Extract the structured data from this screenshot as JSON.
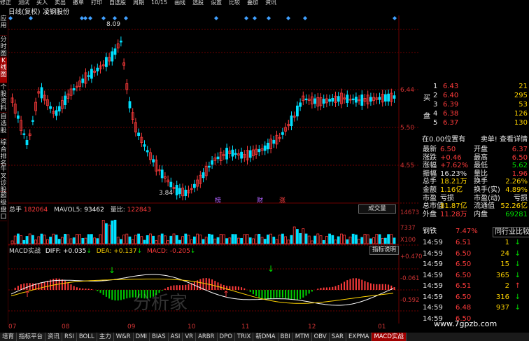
{
  "menu": [
    "修正",
    "测试",
    "买入",
    "卖出",
    "撤单",
    "打印",
    "自选股",
    "周期",
    "10/15",
    "画线",
    "选股",
    "设置",
    "比较",
    "叠加",
    "资讯"
  ],
  "title": {
    "mode": "日线(复权)",
    "stock": "凌钢股份"
  },
  "sidebar": [
    {
      "label": "应用",
      "active": false
    },
    {
      "label": "分时图",
      "active": false
    },
    {
      "label": "K线图",
      "active": true
    },
    {
      "label": "个股资料",
      "active": false
    },
    {
      "label": "自选股",
      "active": false
    },
    {
      "label": "综合排名",
      "active": false
    },
    {
      "label": "牛叉诊股",
      "active": false
    },
    {
      "label": "超级盘口",
      "active": false
    }
  ],
  "price_axis": [
    "6.44",
    "5.50",
    "4.55"
  ],
  "price_marks": {
    "high": "8.09",
    "low": "3.84"
  },
  "event_labels": [
    {
      "text": "榜",
      "color": "#b060ff"
    },
    {
      "text": "财",
      "color": "#b060ff"
    },
    {
      "text": "涨",
      "color": "#ff4040"
    }
  ],
  "volume": {
    "label": "总手",
    "value": "182064",
    "ma_label": "MAVOL5:",
    "ma_value": "93462",
    "ratio_label": "量比:",
    "ratio_value": "122843",
    "axis": [
      "14673",
      "7337",
      "X100"
    ],
    "button": "成交量"
  },
  "macd": {
    "name": "MACD实战",
    "diff": "DIFF: +0.035",
    "dea": "DEA: +0.137",
    "macd": "MACD: -0.205",
    "axis": [
      "+0.470",
      "-0.061",
      "-0.592"
    ],
    "button": "指标说明"
  },
  "dates": [
    "07",
    "08",
    "09",
    "10",
    "11",
    "12",
    "01"
  ],
  "order_book": [
    {
      "side": "卖",
      "level": "1",
      "price": "6.43",
      "vol": "21"
    },
    {
      "side": "",
      "level": "2",
      "price": "6.40",
      "vol": "295"
    },
    {
      "side": "",
      "level": "3",
      "price": "6.39",
      "vol": "53"
    },
    {
      "side": "",
      "level": "4",
      "price": "6.38",
      "vol": "126"
    },
    {
      "side": "",
      "level": "5",
      "price": "6.37",
      "vol": "130"
    }
  ],
  "book_side_labels": [
    "买",
    "盘"
  ],
  "position_line": {
    "left": "在0.00位置有",
    "right": "卖单! 查看详情"
  },
  "quote": [
    {
      "l": "最新",
      "lv": "6.50",
      "lc": "red",
      "r": "开盘",
      "rv": "6.37",
      "rc": "red"
    },
    {
      "l": "涨跌",
      "lv": "+0.46",
      "lc": "red",
      "r": "最高",
      "rv": "6.50",
      "rc": "red"
    },
    {
      "l": "涨幅",
      "lv": "+7.62%",
      "lc": "red",
      "r": "最低",
      "rv": "5.62",
      "rc": "green"
    },
    {
      "l": "振幅",
      "lv": "16.23%",
      "lc": "white",
      "r": "量比",
      "rv": "1.96",
      "rc": "red"
    },
    {
      "l": "总手",
      "lv": "18.21万",
      "lc": "yellow",
      "r": "换手",
      "rv": "2.26%",
      "rc": "yellow"
    },
    {
      "l": "金额",
      "lv": "1.16亿",
      "lc": "yellow",
      "r": "换手(实)",
      "rv": "4.89%",
      "rc": "yellow"
    },
    {
      "l": "市盈",
      "lv": "亏损",
      "lc": "white",
      "r": "市盈(动)",
      "rv": "亏损",
      "rc": "white"
    },
    {
      "l": "总市值",
      "lv": "81.87亿",
      "lc": "yellow",
      "r": "流通值",
      "rv": "52.26亿",
      "rc": "yellow"
    },
    {
      "l": "外盘",
      "lv": "11.28万",
      "lc": "red",
      "r": "内盘",
      "rv": "69281",
      "rc": "green"
    }
  ],
  "sector": {
    "name": "钢铁",
    "pct": "7.47%",
    "button": "同行业比较"
  },
  "ticks": [
    {
      "t": "14:59",
      "p": "6.51",
      "pc": "red",
      "v": "1",
      "arrow": "down"
    },
    {
      "t": "14:59",
      "p": "6.50",
      "pc": "red",
      "v": "24",
      "arrow": "down"
    },
    {
      "t": "14:59",
      "p": "6.50",
      "pc": "red",
      "v": "15",
      "arrow": "down"
    },
    {
      "t": "14:59",
      "p": "6.50",
      "pc": "red",
      "v": "365",
      "arrow": "down"
    },
    {
      "t": "14:59",
      "p": "6.51",
      "pc": "red",
      "v": "2",
      "arrow": "up"
    },
    {
      "t": "14:59",
      "p": "6.50",
      "pc": "red",
      "v": "316",
      "arrow": "down"
    },
    {
      "t": "14:59",
      "p": "6.48",
      "pc": "red",
      "v": "937",
      "arrow": "down"
    },
    {
      "t": "14:59",
      "p": "6.50",
      "pc": "red",
      "v": "",
      "arrow": ""
    }
  ],
  "watermark": "www.7gpzb.com",
  "center_mark": "分析家",
  "bottom_tabs": [
    {
      "label": "培育",
      "on": false
    },
    {
      "label": "指标平台",
      "on": false
    },
    {
      "label": "资讯",
      "on": false
    },
    {
      "label": "RSI",
      "on": false
    },
    {
      "label": "BOLL",
      "on": false
    },
    {
      "label": "主力",
      "on": false
    },
    {
      "label": "W&R",
      "on": false
    },
    {
      "label": "DMI",
      "on": false
    },
    {
      "label": "BIAS",
      "on": false
    },
    {
      "label": "ASI",
      "on": false
    },
    {
      "label": "VR",
      "on": false
    },
    {
      "label": "ARBR",
      "on": false
    },
    {
      "label": "DPO",
      "on": false
    },
    {
      "label": "TRIX",
      "on": false
    },
    {
      "label": "新DMA",
      "on": false
    },
    {
      "label": "BBI",
      "on": false
    },
    {
      "label": "MTM",
      "on": false
    },
    {
      "label": "OBV",
      "on": false
    },
    {
      "label": "SAR",
      "on": false
    },
    {
      "label": "EXPMA",
      "on": false
    },
    {
      "label": "MACD实战",
      "on": true
    }
  ],
  "colors": {
    "up": "#ff3b3b",
    "down": "#00e0ff",
    "grid": "#6b0000",
    "macd_up": "#ff3b3b",
    "macd_down": "#00d000",
    "diff": "#ffffff",
    "dea": "#ffd400"
  }
}
